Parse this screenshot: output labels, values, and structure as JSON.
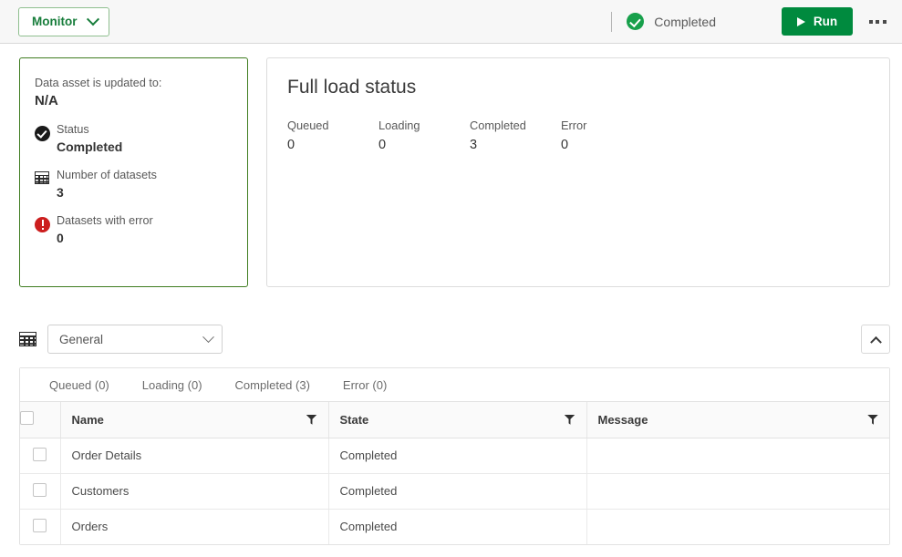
{
  "topbar": {
    "monitor_label": "Monitor",
    "status_label": "Completed",
    "run_label": "Run"
  },
  "info_card": {
    "updated_label": "Data asset is updated to:",
    "updated_value": "N/A",
    "rows": [
      {
        "icon": "check-circle-icon",
        "label": "Status",
        "value": "Completed"
      },
      {
        "icon": "table-icon",
        "label": "Number of datasets",
        "value": "3"
      },
      {
        "icon": "error-circle-icon",
        "label": "Datasets with error",
        "value": "0"
      }
    ]
  },
  "load_panel": {
    "title": "Full load status",
    "stats": [
      {
        "label": "Queued",
        "value": "0"
      },
      {
        "label": "Loading",
        "value": "0"
      },
      {
        "label": "Completed",
        "value": "3"
      },
      {
        "label": "Error",
        "value": "0"
      }
    ]
  },
  "selector": {
    "selected": "General",
    "options": [
      "General"
    ]
  },
  "table": {
    "tabs": [
      {
        "label": "Queued (0)"
      },
      {
        "label": "Loading (0)"
      },
      {
        "label": "Completed (3)"
      },
      {
        "label": "Error (0)"
      }
    ],
    "columns": [
      {
        "label": "Name"
      },
      {
        "label": "State"
      },
      {
        "label": "Message"
      }
    ],
    "rows": [
      {
        "name": "Order Details",
        "state": "Completed",
        "message": ""
      },
      {
        "name": "Customers",
        "state": "Completed",
        "message": ""
      },
      {
        "name": "Orders",
        "state": "Completed",
        "message": ""
      }
    ]
  },
  "colors": {
    "brand_green": "#008a3e",
    "card_border_green": "#3f7d20",
    "status_green": "#17a04b",
    "error_red": "#cc1e1e"
  }
}
